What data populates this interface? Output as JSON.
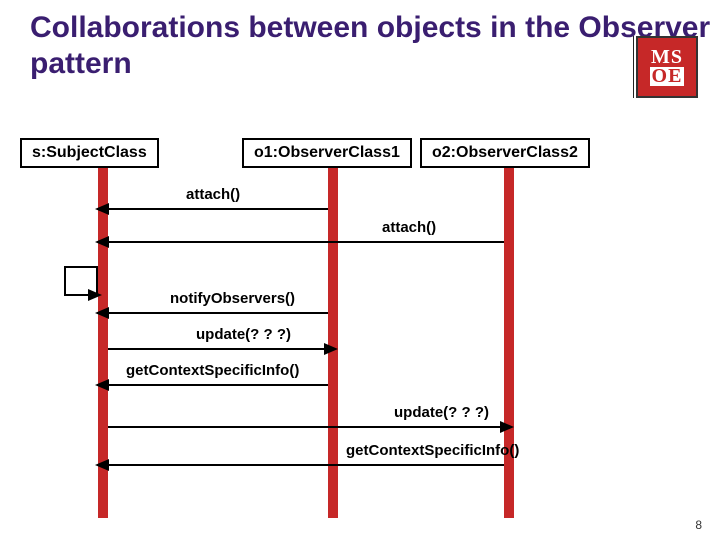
{
  "title": "Collaborations between objects in the Observer pattern",
  "logo": {
    "top": "MS",
    "bottom": "OE"
  },
  "participants": {
    "subject": "s:SubjectClass",
    "observer1": "o1:ObserverClass1",
    "observer2": "o2:ObserverClass2"
  },
  "messages": {
    "attach1": "attach()",
    "attach2": "attach()",
    "notify": "notifyObservers()",
    "update1": "update(? ? ?)",
    "getInfo1": "getContextSpecificInfo()",
    "update2": "update(? ? ?)",
    "getInfo2": "getContextSpecificInfo()"
  },
  "page_number": "8"
}
